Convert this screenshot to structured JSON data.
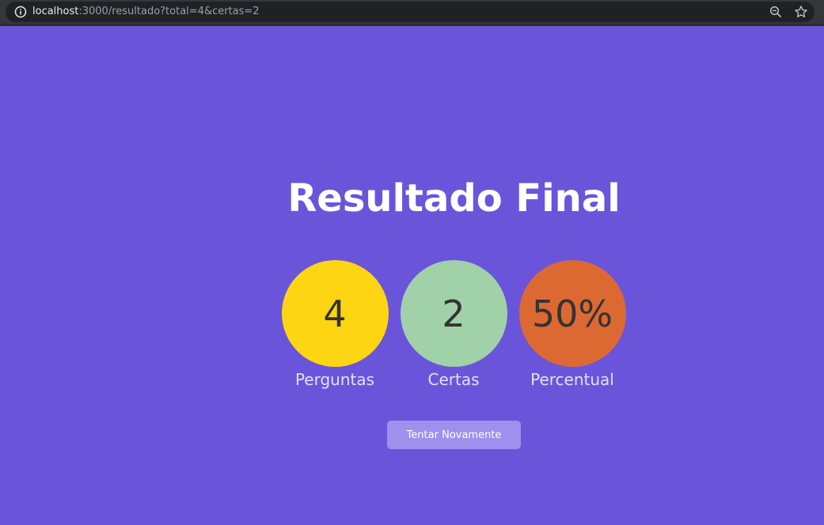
{
  "browser": {
    "url_host": "localhost",
    "url_rest": ":3000/resultado?total=4&certas=2"
  },
  "page": {
    "title": "Resultado Final",
    "background_color": "#6a55da",
    "stats": [
      {
        "value": "4",
        "label": "Perguntas",
        "color": "#fed513"
      },
      {
        "value": "2",
        "label": "Certas",
        "color": "#a0d1a8"
      },
      {
        "value": "50%",
        "label": "Percentual",
        "color": "#dd6932"
      }
    ],
    "retry_button": {
      "label": "Tentar Novamente",
      "color": "#9f90ee"
    }
  }
}
